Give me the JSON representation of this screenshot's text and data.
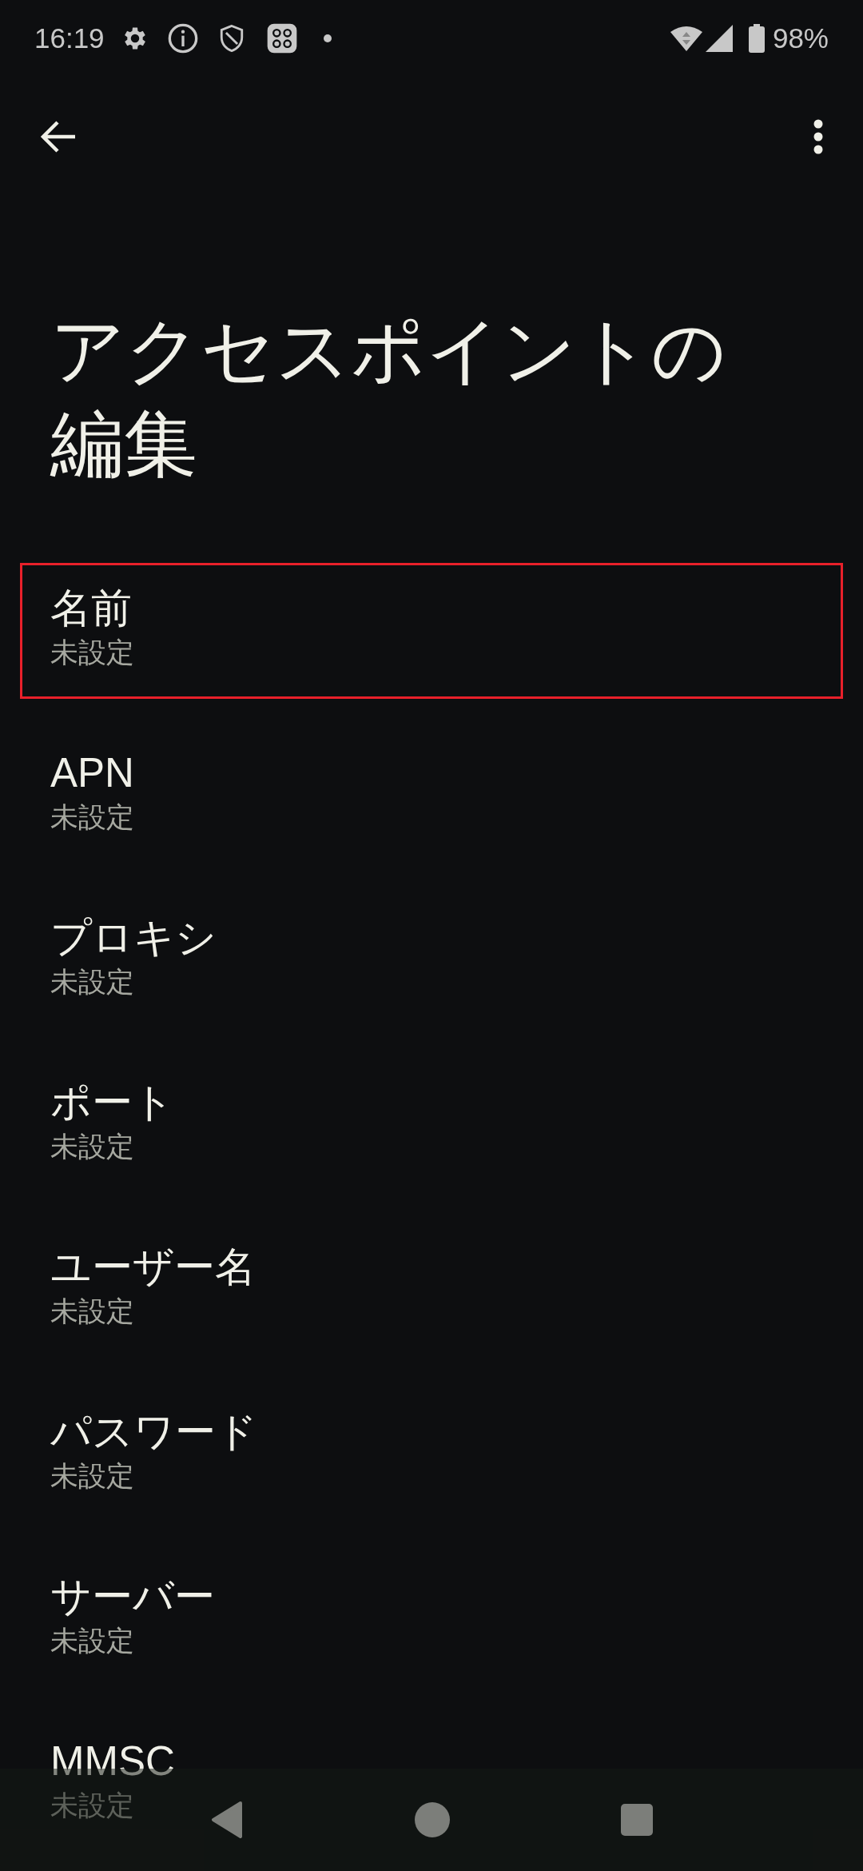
{
  "status_bar": {
    "time": "16:19",
    "battery": "98%"
  },
  "title": "アクセスポイントの編集",
  "items": [
    {
      "label": "名前",
      "value": "未設定",
      "highlighted": true
    },
    {
      "label": "APN",
      "value": "未設定",
      "highlighted": false
    },
    {
      "label": "プロキシ",
      "value": "未設定",
      "highlighted": false
    },
    {
      "label": "ポート",
      "value": "未設定",
      "highlighted": false
    },
    {
      "label": "ユーザー名",
      "value": "未設定",
      "highlighted": false
    },
    {
      "label": "パスワード",
      "value": "未設定",
      "highlighted": false
    },
    {
      "label": "サーバー",
      "value": "未設定",
      "highlighted": false
    },
    {
      "label": "MMSC",
      "value": "未設定",
      "highlighted": false
    }
  ]
}
